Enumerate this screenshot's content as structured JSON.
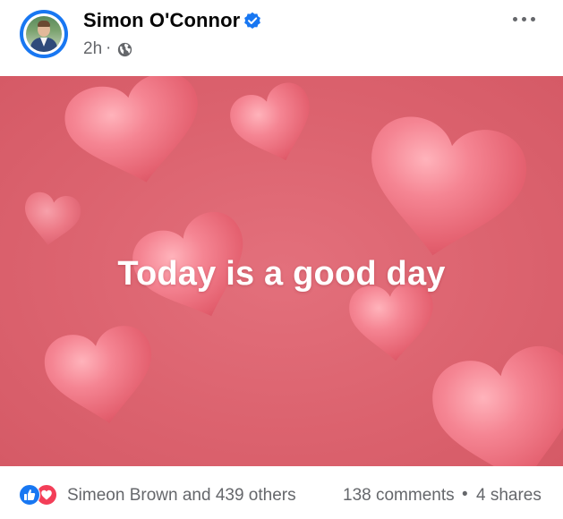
{
  "post": {
    "author": "Simon O'Connor",
    "time": "2h",
    "separator": "·",
    "audience_icon": "globe-icon",
    "verified_icon": "verified-badge-icon",
    "more_icon": "more-options-icon",
    "caption": "Today is a good day"
  },
  "footer": {
    "reaction_icons": [
      "like-reaction-icon",
      "love-reaction-icon"
    ],
    "reactions_text": "Simeon Brown and 439 others",
    "comments": "138 comments",
    "separator": "•",
    "shares": "4 shares"
  },
  "colors": {
    "background_pink": "#dc636f",
    "heart_pink": "#f07f8b",
    "facebook_blue": "#1877f2",
    "love_red": "#f33e58",
    "secondary_text": "#65676b"
  }
}
